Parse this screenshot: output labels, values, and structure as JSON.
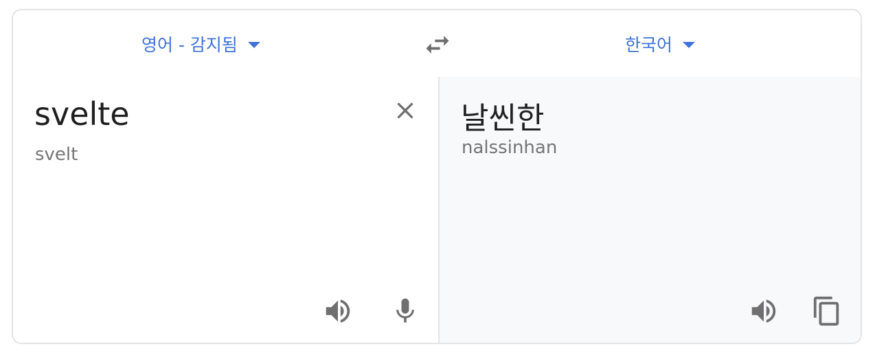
{
  "header": {
    "source_lang": "영어 - 감지됨",
    "target_lang": "한국어"
  },
  "source": {
    "text": "svelte",
    "transliteration": "svelt"
  },
  "target": {
    "text": "날씬한",
    "transliteration": "nalssinhan"
  },
  "icons": {
    "swap": "swap-arrows-icon",
    "clear": "close-icon",
    "speak": "speaker-icon",
    "mic": "microphone-icon",
    "copy": "copy-icon"
  },
  "colors": {
    "accent": "#3f72d8",
    "icon": "#6f6f6f",
    "target_bg": "#f8f9fb"
  }
}
